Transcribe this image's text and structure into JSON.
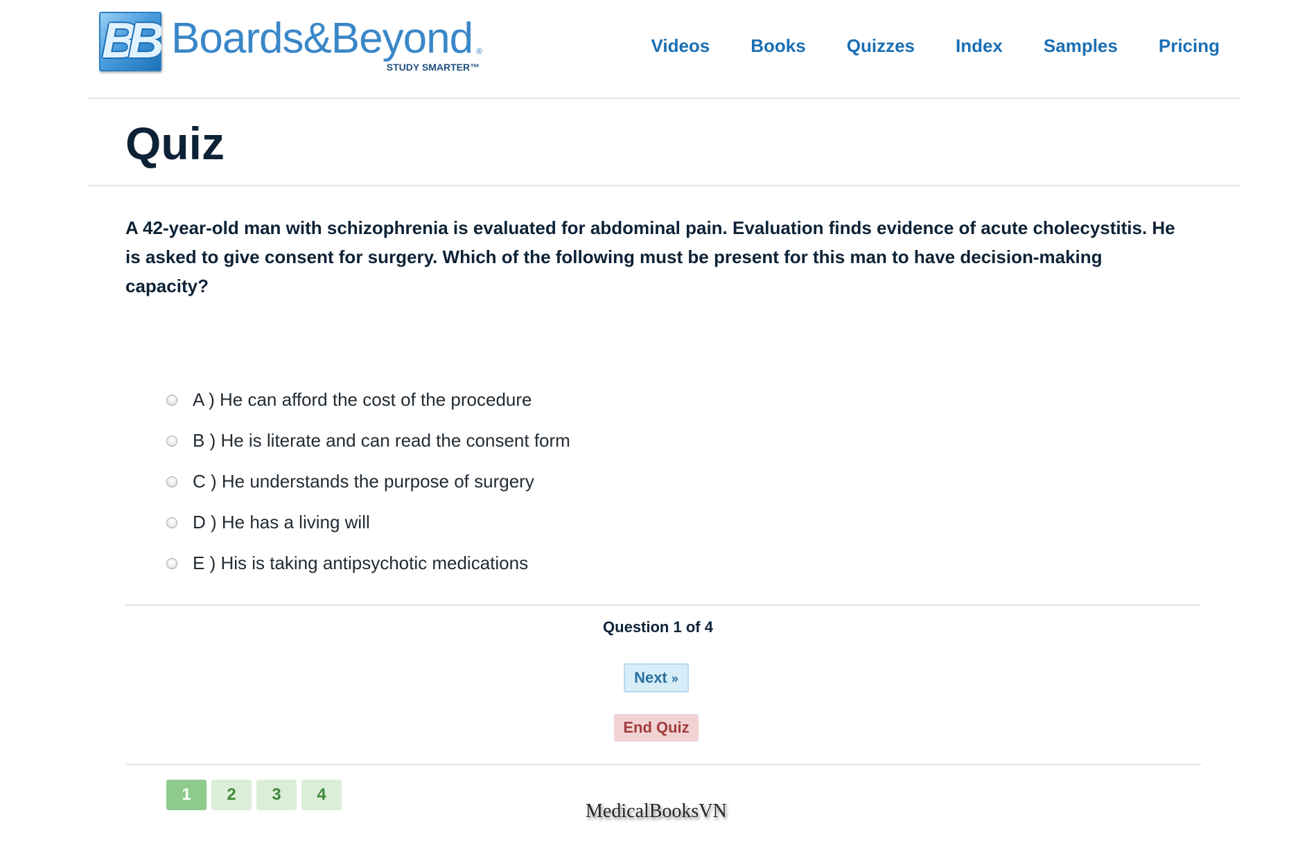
{
  "header": {
    "logo": {
      "icon_name": "bb-logo-icon",
      "letters": "BB",
      "wordmark": "Boards&Beyond",
      "registered": "®",
      "tagline": "STUDY SMARTER™"
    },
    "nav": [
      {
        "label": "Videos"
      },
      {
        "label": "Books"
      },
      {
        "label": "Quizzes"
      },
      {
        "label": "Index"
      },
      {
        "label": "Samples"
      },
      {
        "label": "Pricing"
      }
    ]
  },
  "page": {
    "title": "Quiz"
  },
  "question": {
    "text": "A 42-year-old man with schizophrenia is evaluated for abdominal pain. Evaluation finds evidence of acute cholecystitis. He is asked to give consent for surgery. Which of the following must be present for this man to have decision-making capacity?",
    "options": [
      {
        "label": "A ) He can afford the cost of the procedure"
      },
      {
        "label": "B ) He is literate and can read the consent form"
      },
      {
        "label": "C ) He understands the purpose of surgery"
      },
      {
        "label": "D ) He has a living will"
      },
      {
        "label": "E ) His is taking antipsychotic medications"
      }
    ]
  },
  "controls": {
    "counter": "Question 1 of 4",
    "next_label": "Next",
    "next_suffix": "»",
    "end_label": "End Quiz"
  },
  "pager": {
    "current": 1,
    "pages": [
      "1",
      "2",
      "3",
      "4"
    ]
  },
  "watermark": "MedicalBooksVN",
  "colors": {
    "brand_blue": "#1a6fb4",
    "title_navy": "#0d2236",
    "next_bg": "#d7edf8",
    "end_bg": "#f1d3d3",
    "end_text": "#a33a3a",
    "page_current_bg": "#8ecb8c",
    "page_bg": "#dbeed8"
  }
}
